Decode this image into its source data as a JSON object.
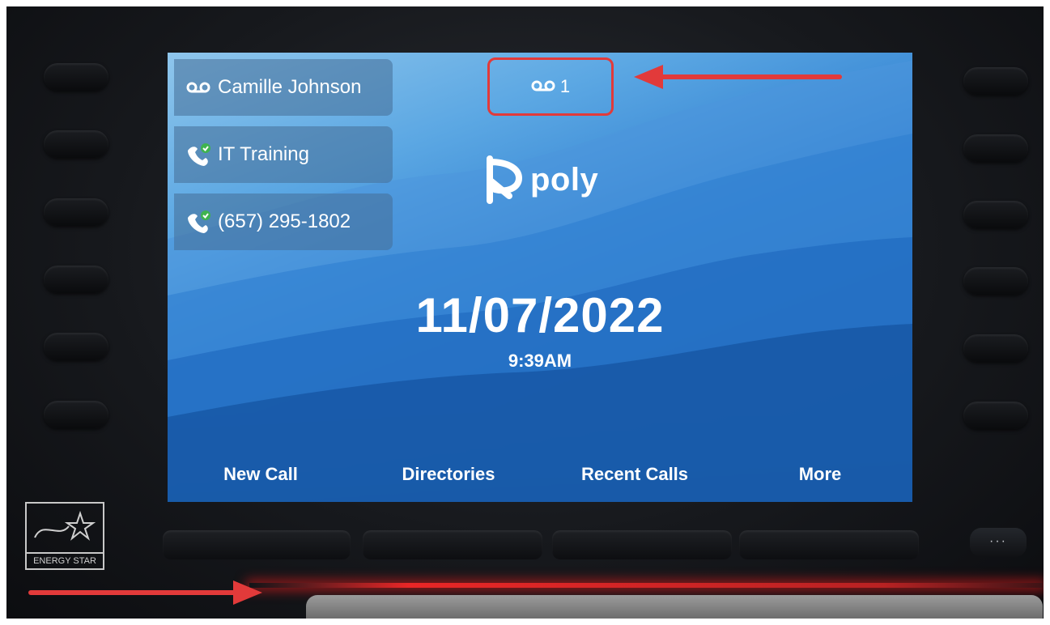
{
  "lines": [
    {
      "label": "Camille Johnson",
      "icon": "voicemail-icon"
    },
    {
      "label": "IT Training",
      "icon": "registered-line-icon"
    },
    {
      "label": "(657) 295-1802",
      "icon": "registered-line-icon"
    }
  ],
  "voicemail": {
    "count": "1",
    "icon": "voicemail-icon"
  },
  "logo": {
    "text": "poly"
  },
  "date": "11/07/2022",
  "time": "9:39AM",
  "softkeys": [
    "New Call",
    "Directories",
    "Recent Calls",
    "More"
  ],
  "more_button_label": "···",
  "energy_star": {
    "text": "ENERGY STAR"
  },
  "colors": {
    "annotation_red": "#e23a3a",
    "screen_blue": "#2f7fd0"
  }
}
